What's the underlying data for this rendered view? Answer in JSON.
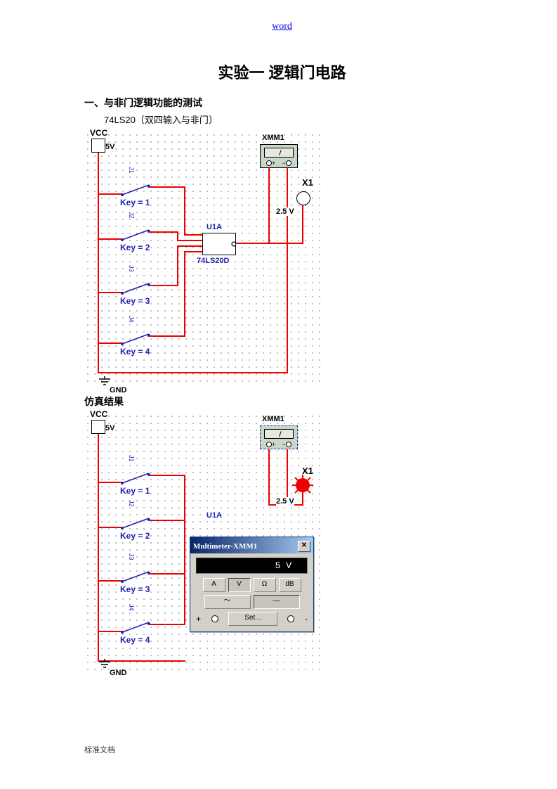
{
  "header_link": "word",
  "title": "实验一  逻辑门电路",
  "section1_heading": "一、与非门逻辑功能的测试",
  "chip_line": "74LS20〔双四输入与非门〕",
  "circuit": {
    "vcc": "VCC",
    "vcc_val": "5V",
    "gnd": "GND",
    "keys": [
      "Key = 1",
      "Key = 2",
      "Key = 3",
      "Key = 4"
    ],
    "j_lbls": [
      "J1",
      "J2",
      "J3",
      "J4"
    ],
    "ic_ref": "U1A",
    "ic_part": "74LS20D",
    "xmm": "XMM1",
    "x1": "X1",
    "x1_volt": "2.5 V"
  },
  "sim_heading": "仿真结果",
  "multimeter": {
    "title": "Multimeter-XMM1",
    "close": "✕",
    "reading": "5 V",
    "btn_a": "A",
    "btn_v": "V",
    "btn_ohm": "Ω",
    "btn_db": "dB",
    "btn_ac": "〜",
    "btn_dc": "—",
    "btn_set": "Set...",
    "plus": "+",
    "minus": "-"
  },
  "footer": "标准文档"
}
